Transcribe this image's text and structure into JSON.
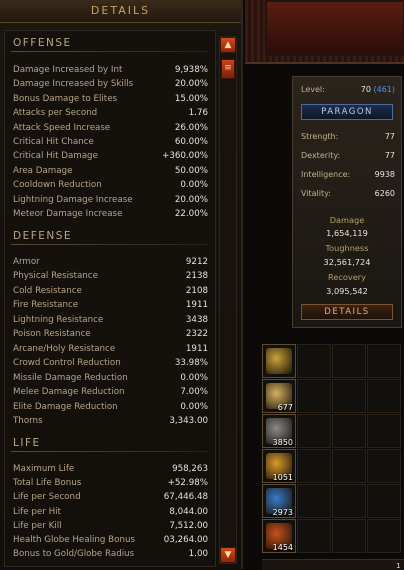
{
  "details_panel": {
    "header": "DETAILS",
    "sections": [
      {
        "title": "OFFENSE",
        "rows": [
          {
            "label": "Damage Increased by Int",
            "value": "9,938%"
          },
          {
            "label": "Damage Increased by Skills",
            "value": "20.00%"
          },
          {
            "label": "Bonus Damage to Elites",
            "value": "15.00%"
          },
          {
            "label": "Attacks per Second",
            "value": "1.76"
          },
          {
            "label": "Attack Speed Increase",
            "value": "26.00%"
          },
          {
            "label": "Critical Hit Chance",
            "value": "60.00%"
          },
          {
            "label": "Critical Hit Damage",
            "value": "+360.00%"
          },
          {
            "label": "Area Damage",
            "value": "50.00%"
          },
          {
            "label": "Cooldown Reduction",
            "value": "0.00%"
          },
          {
            "label": "Lightning Damage Increase",
            "value": "20.00%"
          },
          {
            "label": "Meteor Damage Increase",
            "value": "22.00%"
          }
        ]
      },
      {
        "title": "DEFENSE",
        "rows": [
          {
            "label": "Armor",
            "value": "9212"
          },
          {
            "label": "Physical Resistance",
            "value": "2138"
          },
          {
            "label": "Cold Resistance",
            "value": "2108"
          },
          {
            "label": "Fire Resistance",
            "value": "1911"
          },
          {
            "label": "Lightning Resistance",
            "value": "3438"
          },
          {
            "label": "Poison Resistance",
            "value": "2322"
          },
          {
            "label": "Arcane/Holy Resistance",
            "value": "1911"
          },
          {
            "label": "Crowd Control Reduction",
            "value": "33.98%"
          },
          {
            "label": "Missile Damage Reduction",
            "value": "0.00%"
          },
          {
            "label": "Melee Damage Reduction",
            "value": "7.00%"
          },
          {
            "label": "Elite Damage Reduction",
            "value": "0.00%"
          },
          {
            "label": "Thorns",
            "value": "3,343.00"
          }
        ]
      },
      {
        "title": "LIFE",
        "rows": [
          {
            "label": "Maximum Life",
            "value": "958,263"
          },
          {
            "label": "Total Life Bonus",
            "value": "+52.98%"
          },
          {
            "label": "Life per Second",
            "value": "67,446.48"
          },
          {
            "label": "Life per Hit",
            "value": "8,044.00"
          },
          {
            "label": "Life per Kill",
            "value": "7,512.00"
          },
          {
            "label": "Health Globe Healing Bonus",
            "value": "03,264.00"
          },
          {
            "label": "Bonus to Gold/Globe Radius",
            "value": "1.00"
          }
        ]
      }
    ],
    "scroll_up_icon": "arrow-up-icon",
    "scroll_down_icon": "arrow-down-icon"
  },
  "stats_panel": {
    "level_label": "Level:",
    "level_value": "70",
    "paragon_level": "(461)",
    "paragon_button": "PARAGON",
    "attributes": [
      {
        "label": "Strength:",
        "value": "77"
      },
      {
        "label": "Dexterity:",
        "value": "77"
      },
      {
        "label": "Intelligence:",
        "value": "9938"
      },
      {
        "label": "Vitality:",
        "value": "6260"
      }
    ],
    "summary": [
      {
        "label": "Damage",
        "value": "1,654,119"
      },
      {
        "label": "Toughness",
        "value": "32,561,724"
      },
      {
        "label": "Recovery",
        "value": "3,095,542"
      }
    ],
    "details_button": "DETAILS"
  },
  "inventory": {
    "items": [
      {
        "icon": "scroll-icon",
        "count": "",
        "color": "#c8a23a"
      },
      {
        "icon": "potion-icon",
        "count": "677",
        "color": "#d4b060"
      },
      {
        "icon": "crafting-material-icon",
        "count": "3850",
        "color": "#8a8a8a"
      },
      {
        "icon": "legendary-material-icon",
        "count": "1051",
        "color": "#d99a2a"
      },
      {
        "icon": "crystal-icon",
        "count": "2973",
        "color": "#3a7ac8"
      },
      {
        "icon": "fire-material-icon",
        "count": "1454",
        "color": "#c8501e"
      }
    ],
    "corner_text": "1"
  }
}
